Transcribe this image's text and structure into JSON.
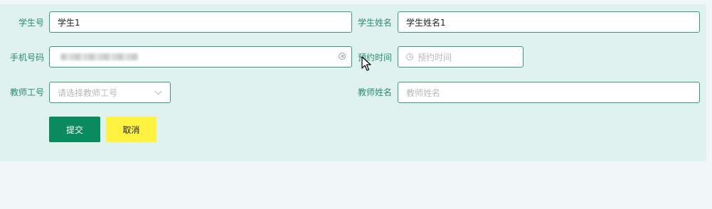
{
  "form": {
    "student_id": {
      "label": "学生号",
      "value": "学生1"
    },
    "student_name": {
      "label": "学生姓名",
      "value": "学生姓名1"
    },
    "phone": {
      "label": "手机号码"
    },
    "appointment_time": {
      "label": "预约时间",
      "placeholder": "预约时间"
    },
    "teacher_id": {
      "label": "教师工号",
      "placeholder": "请选择教师工号"
    },
    "teacher_name": {
      "label": "教师姓名",
      "placeholder": "教师姓名"
    }
  },
  "buttons": {
    "submit": "提交",
    "cancel": "取消"
  },
  "colors": {
    "label": "#2b8b6d",
    "border": "#3a9a7c",
    "submit": "#0a8a5f",
    "cancel": "#fff240",
    "panel": "#dff2ed"
  }
}
